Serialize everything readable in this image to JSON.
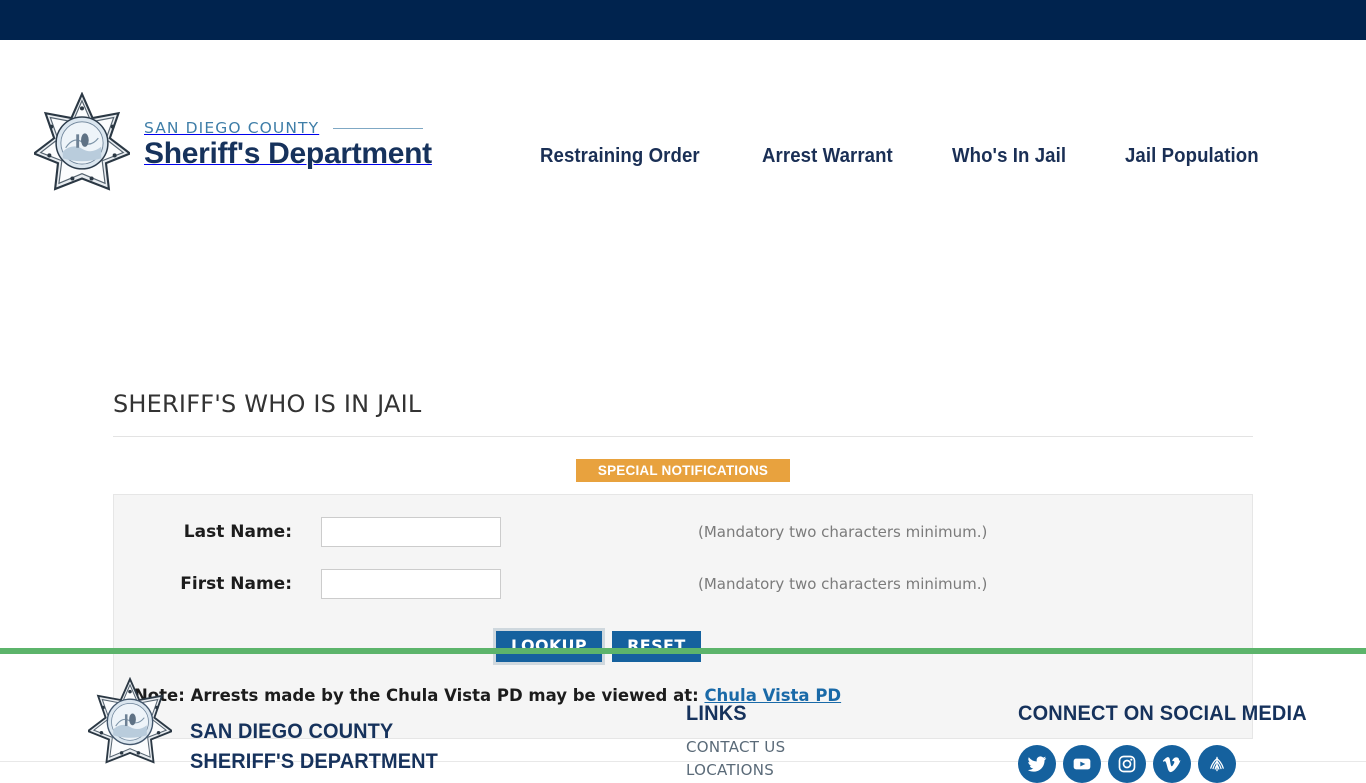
{
  "header": {
    "logo_icon": "sheriff-star-badge-icon",
    "brand_line1": "SAN DIEGO COUNTY",
    "brand_line2": "Sheriff's Department",
    "nav": [
      {
        "label": "Restraining Order"
      },
      {
        "label": "Arrest Warrant"
      },
      {
        "label": "Who's In Jail"
      },
      {
        "label": "Jail Population"
      }
    ]
  },
  "main": {
    "page_title": "SHERIFF'S WHO IS IN JAIL",
    "notification_badge": "SPECIAL NOTIFICATIONS",
    "form": {
      "last_name": {
        "label": "Last Name:",
        "value": "",
        "placeholder": "",
        "hint": "(Mandatory two characters minimum.)"
      },
      "first_name": {
        "label": "First Name:",
        "value": "",
        "placeholder": "",
        "hint": "(Mandatory two characters minimum.)"
      },
      "lookup_label": "LOOKUP",
      "reset_label": "RESET"
    },
    "note_text": "Note: Arrests made by the Chula Vista PD may be viewed at:",
    "note_link": "Chula Vista PD"
  },
  "footer": {
    "logo_icon": "sheriff-star-badge-icon",
    "brand_line1": "SAN DIEGO COUNTY",
    "brand_line2": "SHERIFF'S DEPARTMENT",
    "links_heading": "LINKS",
    "links": [
      {
        "label": "CONTACT US"
      },
      {
        "label": "LOCATIONS"
      }
    ],
    "social_heading": "CONNECT ON SOCIAL MEDIA",
    "social": [
      {
        "icon": "twitter-icon"
      },
      {
        "icon": "youtube-icon"
      },
      {
        "icon": "instagram-icon"
      },
      {
        "icon": "vimeo-icon"
      },
      {
        "icon": "nextdoor-icon"
      }
    ]
  },
  "colors": {
    "topbar_navy": "#00234e",
    "brand_navy": "#16325c",
    "accent_orange": "#e8a23e",
    "button_blue": "#15619e",
    "footer_green": "#5cb46b",
    "link_blue": "#1a6aa8"
  }
}
